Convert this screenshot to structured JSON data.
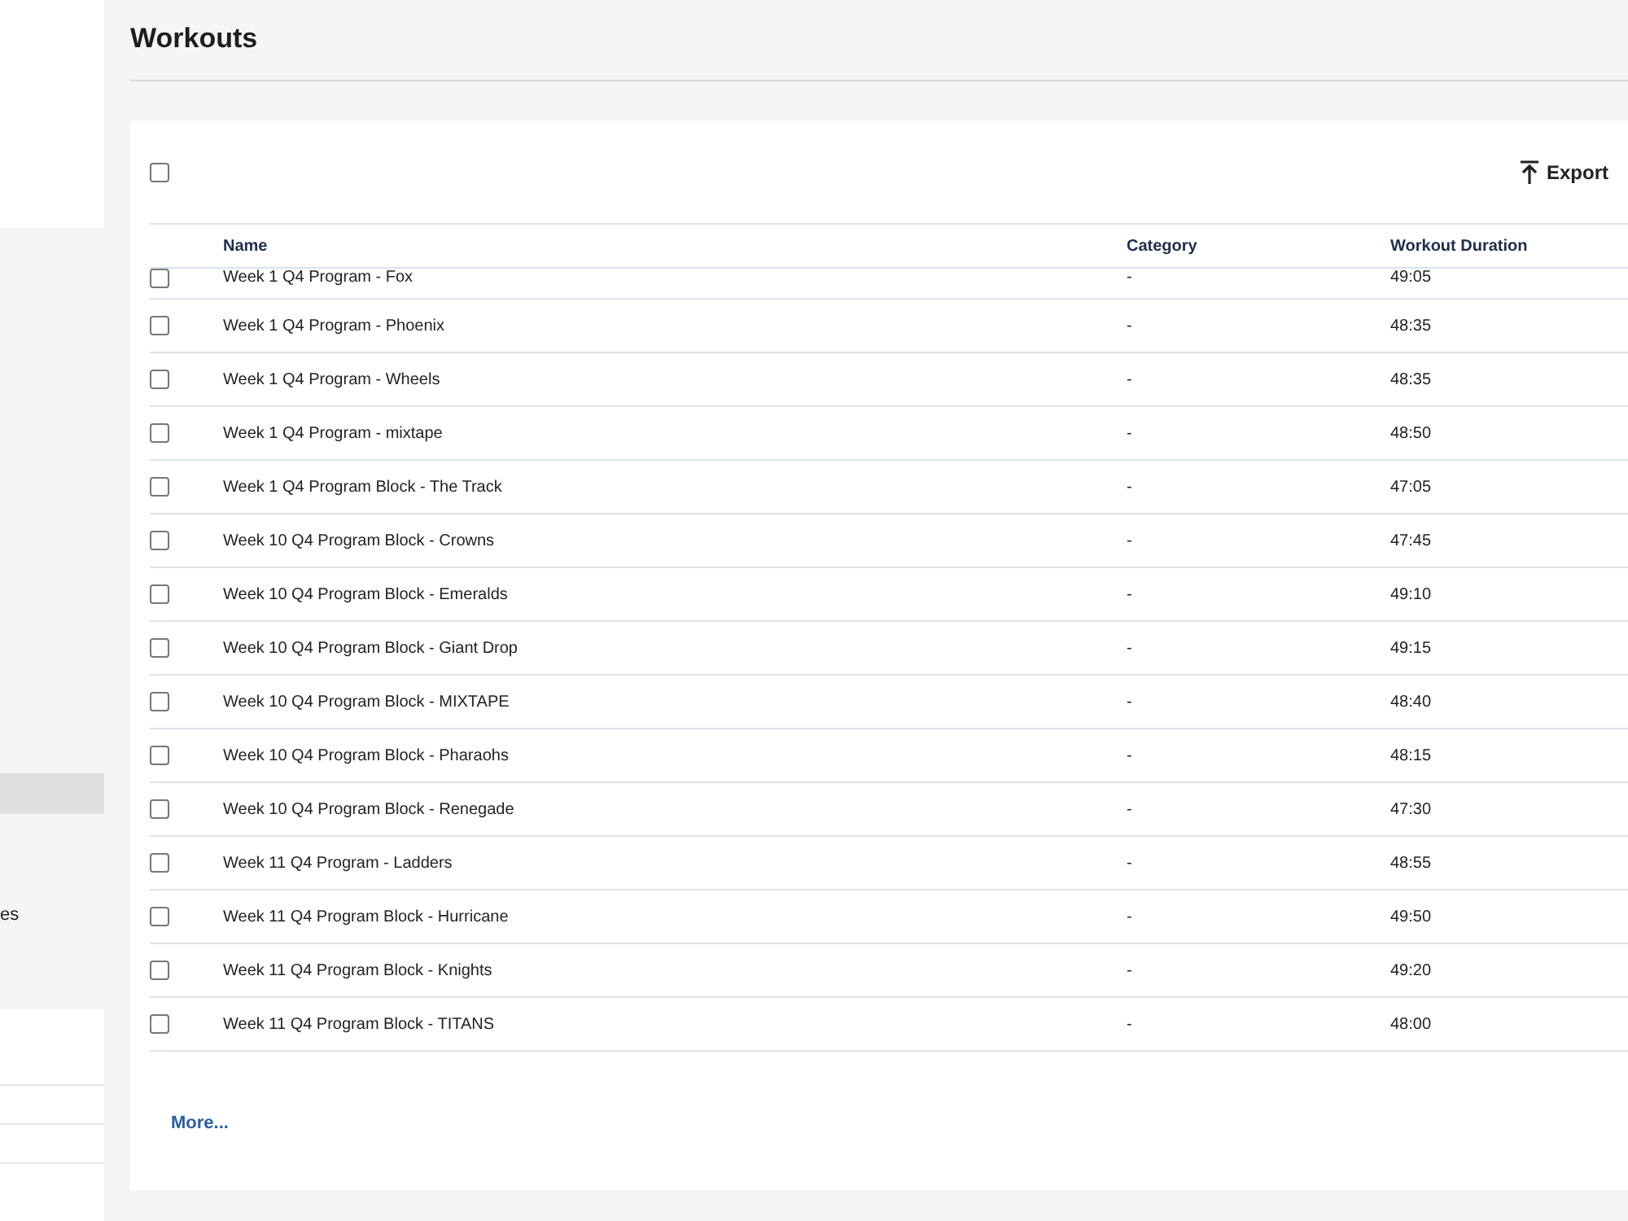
{
  "sidebar": {
    "items": [
      {
        "label": "es"
      }
    ]
  },
  "page": {
    "title": "Workouts"
  },
  "table": {
    "select_all": {
      "checked": false
    },
    "export_label": "Export",
    "columns": [
      "Name",
      "Category",
      "Workout Duration"
    ],
    "rows": [
      {
        "checked": false,
        "cells": [
          "Week 1 Q4 Program - Fox",
          "-",
          "49:05"
        ]
      },
      {
        "checked": false,
        "cells": [
          "Week 1 Q4 Program - Phoenix",
          "-",
          "48:35"
        ]
      },
      {
        "checked": false,
        "cells": [
          "Week 1 Q4 Program - Wheels",
          "-",
          "48:35"
        ]
      },
      {
        "checked": false,
        "cells": [
          "Week 1 Q4 Program - mixtape",
          "-",
          "48:50"
        ]
      },
      {
        "checked": false,
        "cells": [
          "Week 1 Q4 Program Block - The Track",
          "-",
          "47:05"
        ]
      },
      {
        "checked": false,
        "cells": [
          "Week 10 Q4 Program Block - Crowns",
          "-",
          "47:45"
        ]
      },
      {
        "checked": false,
        "cells": [
          "Week 10 Q4 Program Block - Emeralds",
          "-",
          "49:10"
        ]
      },
      {
        "checked": false,
        "cells": [
          "Week 10 Q4 Program Block - Giant Drop",
          "-",
          "49:15"
        ]
      },
      {
        "checked": false,
        "cells": [
          "Week 10 Q4 Program Block - MIXTAPE",
          "-",
          "48:40"
        ]
      },
      {
        "checked": false,
        "cells": [
          "Week 10 Q4 Program Block - Pharaohs",
          "-",
          "48:15"
        ]
      },
      {
        "checked": false,
        "cells": [
          "Week 10 Q4 Program Block - Renegade",
          "-",
          "47:30"
        ]
      },
      {
        "checked": false,
        "cells": [
          "Week 11 Q4 Program - Ladders",
          "-",
          "48:55"
        ]
      },
      {
        "checked": false,
        "cells": [
          "Week 11 Q4 Program Block - Hurricane",
          "-",
          "49:50"
        ]
      },
      {
        "checked": false,
        "cells": [
          "Week 11 Q4 Program Block - Knights",
          "-",
          "49:20"
        ]
      },
      {
        "checked": false,
        "cells": [
          "Week 11 Q4 Program Block - TITANS",
          "-",
          "48:00"
        ]
      }
    ],
    "more_link": "More..."
  }
}
